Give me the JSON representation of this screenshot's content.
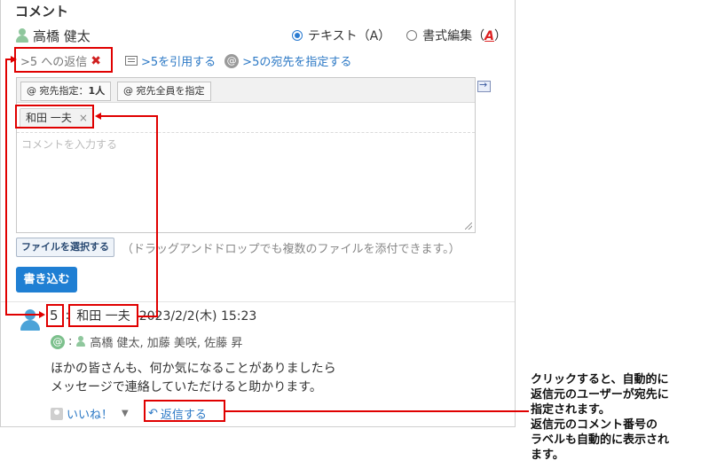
{
  "section_title": "コメント",
  "author": "高橋 健太",
  "mode": {
    "text_label": "テキスト（A）",
    "rich_label": "書式編集（",
    "rich_key": "A",
    "rich_close": "）"
  },
  "reply": {
    "label": ">5 への返信",
    "close": "✖"
  },
  "actions": {
    "quote": ">5を引用する",
    "mention": ">5の宛先を指定する",
    "at_symbol": "@"
  },
  "editor": {
    "dest_specified_prefix": "@ 宛先指定：",
    "dest_specified_count": "1人",
    "dest_all": "@ 宛先全員を指定",
    "chip_name": "和田 一夫",
    "chip_close": "×",
    "placeholder": "コメントを入力する"
  },
  "file": {
    "button": "ファイルを選択する",
    "hint": "（ドラッグアンドドロップでも複数のファイルを添付できます。）"
  },
  "submit": "書き込む",
  "comment": {
    "number": "5",
    "separator": ":",
    "author": "和田 一夫",
    "date": "2023/2/2(木) 15:23",
    "to_sep": ":",
    "to_users": "高橋 健太,  加藤 美咲,  佐藤 昇",
    "body_line1": "ほかの皆さんも、何か気になることがありましたら",
    "body_line2": "メッセージで連絡していただけると助かります。",
    "like": "いいね！",
    "reply": "返信する"
  },
  "annotation": {
    "line1": "クリックすると、自動的に",
    "line2": "返信元のユーザーが宛先に",
    "line3": "指定されます。",
    "line4": "返信元のコメント番号の",
    "line5": "ラベルも自動的に表示され",
    "line6": "ます。"
  },
  "colors": {
    "accent": "#1f7fd3",
    "link": "#2b78c5",
    "annotation_red": "#e00000"
  }
}
